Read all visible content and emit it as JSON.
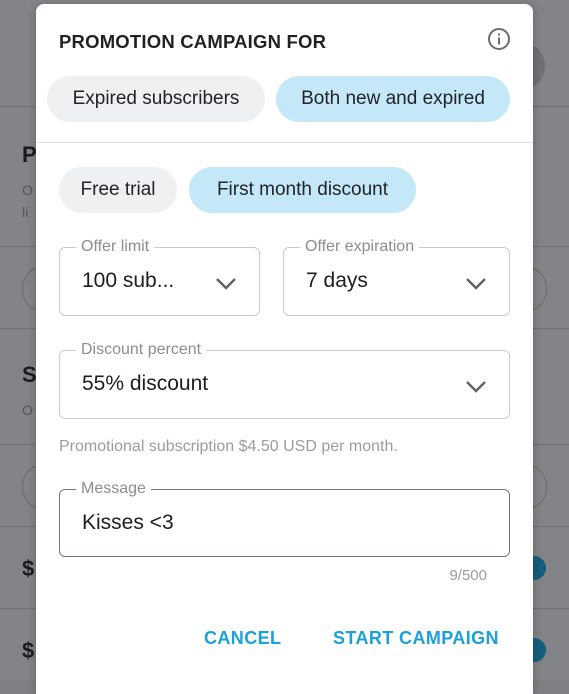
{
  "background": {
    "section_letters": [
      "P",
      "S",
      "$",
      "$"
    ]
  },
  "dialog": {
    "title": "PROMOTION CAMPAIGN FOR",
    "audience_options": [
      {
        "label": "Expired subscribers",
        "selected": false
      },
      {
        "label": "Both new and expired",
        "selected": true
      }
    ],
    "offer_types": [
      {
        "label": "Free trial",
        "selected": false
      },
      {
        "label": "First month discount",
        "selected": true
      }
    ],
    "offer_limit": {
      "label": "Offer limit",
      "value": "100 sub..."
    },
    "offer_expiration": {
      "label": "Offer expiration",
      "value": "7 days"
    },
    "discount_percent": {
      "label": "Discount percent",
      "value": "55% discount"
    },
    "promo_hint": "Promotional subscription $4.50 USD per month.",
    "message": {
      "label": "Message",
      "value": "Kisses <3",
      "counter": "9/500"
    },
    "actions": {
      "cancel": "CANCEL",
      "start": "START CAMPAIGN"
    }
  },
  "colors": {
    "accent": "#1ba1d9",
    "chip_selected": "#c4e8f8",
    "chip_default": "#eff0f2"
  }
}
